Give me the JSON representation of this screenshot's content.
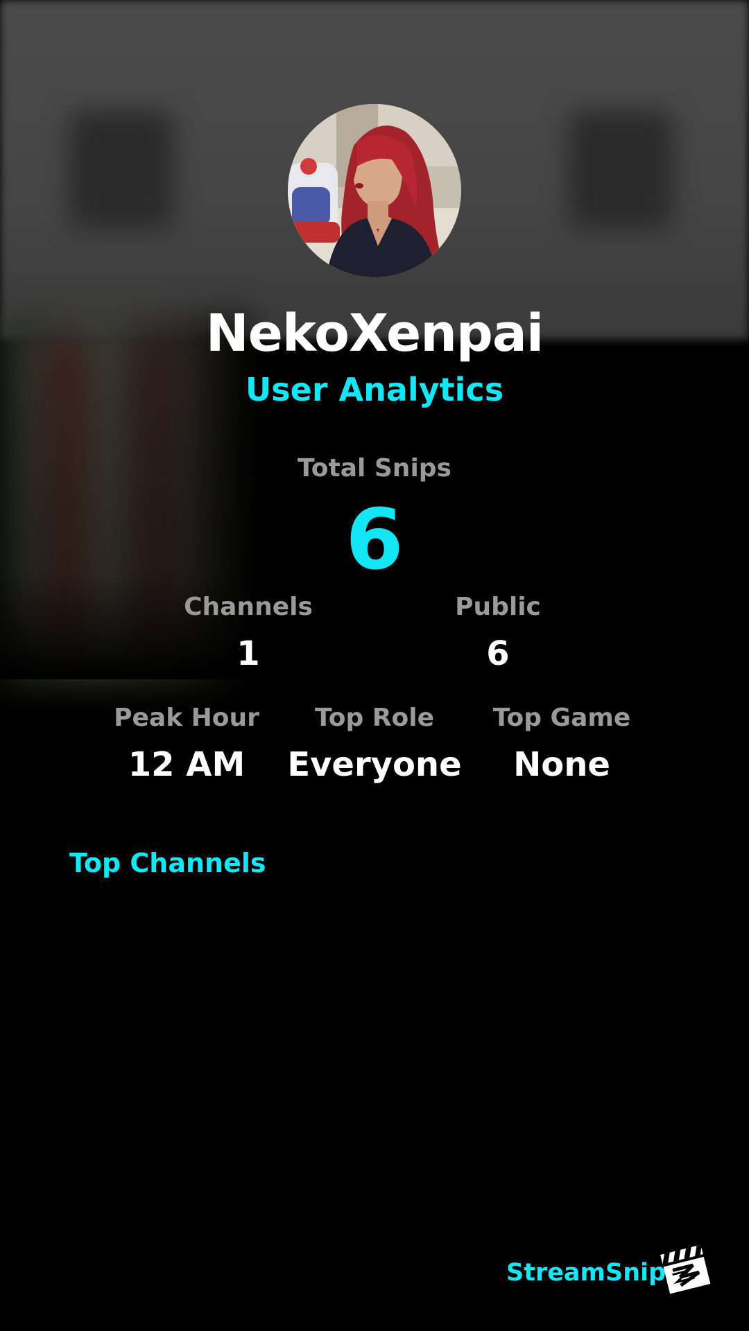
{
  "profile": {
    "username": "NekoXenpai",
    "subtitle": "User Analytics",
    "avatar_icon": "user-avatar-photo"
  },
  "stats": {
    "total_snips_label": "Total Snips",
    "total_snips_value": "6",
    "channels_label": "Channels",
    "channels_value": "1",
    "public_label": "Public",
    "public_value": "6",
    "peak_hour_label": "Peak Hour",
    "peak_hour_value": "12 AM",
    "top_role_label": "Top Role",
    "top_role_value": "Everyone",
    "top_game_label": "Top Game",
    "top_game_value": "None"
  },
  "sections": {
    "top_channels_title": "Top Channels"
  },
  "branding": {
    "name": "StreamSnip",
    "logo_icon": "clapperboard-logo-icon"
  },
  "colors": {
    "accent": "#14e6f5",
    "label": "#9a9a9a",
    "text": "#ffffff",
    "background": "#000000"
  }
}
